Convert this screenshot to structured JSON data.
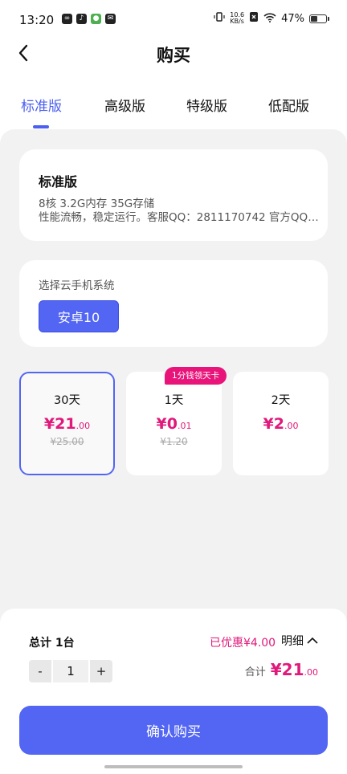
{
  "status_bar": {
    "time": "13:20",
    "net_speed_value": "10.6",
    "net_speed_unit": "KB/s",
    "battery": "47%"
  },
  "header": {
    "title": "购买"
  },
  "tabs": [
    {
      "label": "标准版",
      "active": true
    },
    {
      "label": "高级版",
      "active": false
    },
    {
      "label": "特级版",
      "active": false
    },
    {
      "label": "低配版",
      "active": false
    }
  ],
  "product": {
    "name": "标准版",
    "specs": "8核 3.2G内存 35G存储",
    "description": "性能流畅，稳定运行。客服QQ：2811170742  官方QQ群：…"
  },
  "system": {
    "label": "选择云手机系统",
    "selected": "安卓10"
  },
  "plans": [
    {
      "duration": "30天",
      "currency": "¥",
      "price_int": "21",
      "price_dec": ".00",
      "original": "¥25.00",
      "selected": true
    },
    {
      "duration": "1天",
      "currency": "¥",
      "price_int": "0",
      "price_dec": ".01",
      "original": "¥1.20",
      "selected": false,
      "badge": "1分钱领天卡"
    },
    {
      "duration": "2天",
      "currency": "¥",
      "price_int": "2",
      "price_dec": ".00",
      "original": "",
      "selected": false
    }
  ],
  "summary": {
    "total_label": "总计  1台",
    "discount": "已优惠¥4.00",
    "detail": "明细",
    "quantity": "1",
    "minus": "-",
    "plus": "+",
    "sum_label": "合计",
    "sum_int": "¥21",
    "sum_dec": ".00"
  },
  "confirm_button": "确认购买",
  "colors": {
    "accent": "#5265f3",
    "price": "#e0197a",
    "badge": "#e8147a"
  }
}
